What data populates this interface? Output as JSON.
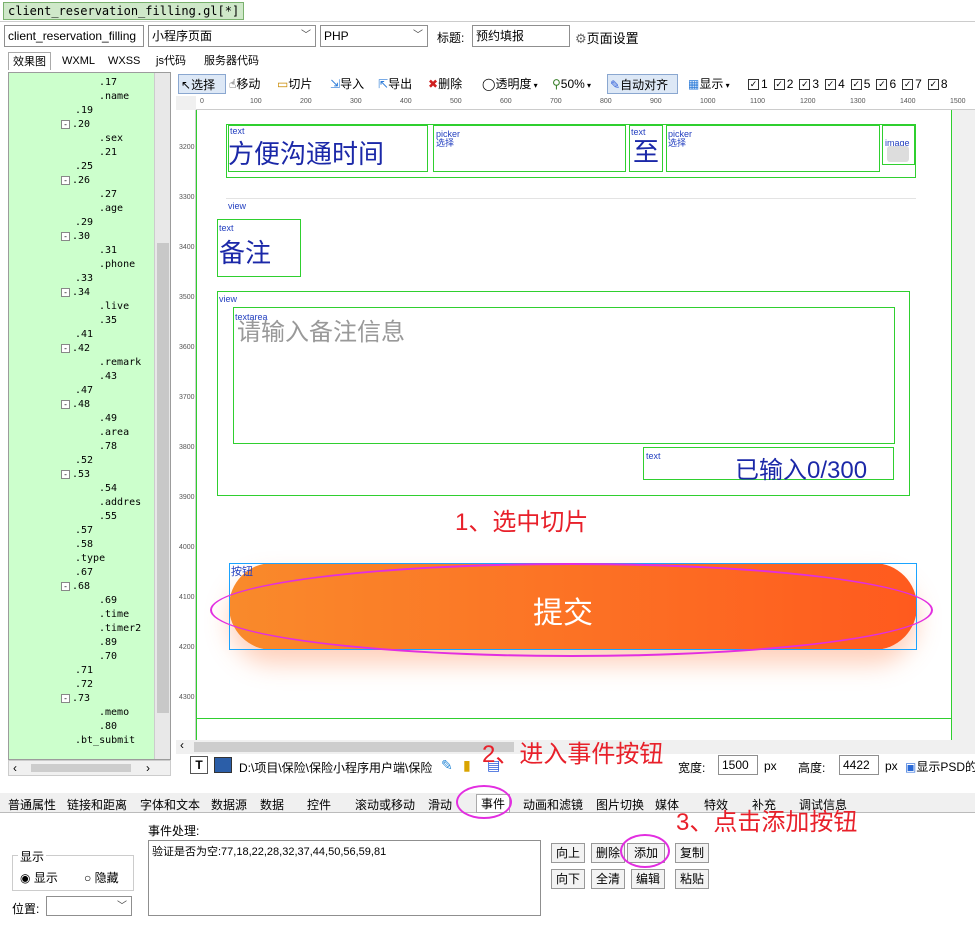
{
  "window": {
    "title_tab": "client_reservation_filling.gl[*]"
  },
  "row1": {
    "page_name": "client_reservation_filling",
    "page_type": "小程序页面",
    "language": "PHP",
    "title_label": "标题:",
    "title_value": "预约填报",
    "page_settings": "页面设置"
  },
  "left_tabs": [
    "效果图",
    "WXML",
    "WXSS",
    "js代码",
    "服务器代码"
  ],
  "tree": {
    "rows": [
      {
        "t": ".17",
        "d": 3
      },
      {
        "t": ".name",
        "d": 3
      },
      {
        "t": ".19",
        "d": 2
      },
      {
        "t": ".20",
        "d": 2,
        "box": "-"
      },
      {
        "t": ".sex",
        "d": 3
      },
      {
        "t": ".21",
        "d": 3
      },
      {
        "t": ".25",
        "d": 2
      },
      {
        "t": ".26",
        "d": 2,
        "box": "-"
      },
      {
        "t": ".27",
        "d": 3
      },
      {
        "t": ".age",
        "d": 3
      },
      {
        "t": ".29",
        "d": 2
      },
      {
        "t": ".30",
        "d": 2,
        "box": "-"
      },
      {
        "t": ".31",
        "d": 3
      },
      {
        "t": ".phone",
        "d": 3
      },
      {
        "t": ".33",
        "d": 2
      },
      {
        "t": ".34",
        "d": 2,
        "box": "-"
      },
      {
        "t": ".live",
        "d": 3
      },
      {
        "t": ".35",
        "d": 3
      },
      {
        "t": ".41",
        "d": 2
      },
      {
        "t": ".42",
        "d": 2,
        "box": "-"
      },
      {
        "t": ".remark",
        "d": 3
      },
      {
        "t": ".43",
        "d": 3
      },
      {
        "t": ".47",
        "d": 2
      },
      {
        "t": ".48",
        "d": 2,
        "box": "-"
      },
      {
        "t": ".49",
        "d": 3
      },
      {
        "t": ".area",
        "d": 3
      },
      {
        "t": ".78",
        "d": 3
      },
      {
        "t": ".52",
        "d": 2
      },
      {
        "t": ".53",
        "d": 2,
        "box": "-"
      },
      {
        "t": ".54",
        "d": 3
      },
      {
        "t": ".addres",
        "d": 3
      },
      {
        "t": ".55",
        "d": 3
      },
      {
        "t": ".57",
        "d": 2
      },
      {
        "t": ".58",
        "d": 2
      },
      {
        "t": ".type",
        "d": 2
      },
      {
        "t": ".67",
        "d": 2
      },
      {
        "t": ".68",
        "d": 2,
        "box": "-"
      },
      {
        "t": ".69",
        "d": 3
      },
      {
        "t": ".time",
        "d": 3
      },
      {
        "t": ".timer2",
        "d": 3
      },
      {
        "t": ".89",
        "d": 3
      },
      {
        "t": ".70",
        "d": 3
      },
      {
        "t": ".71",
        "d": 2
      },
      {
        "t": ".72",
        "d": 2
      },
      {
        "t": ".73",
        "d": 2,
        "box": "-"
      },
      {
        "t": ".memo",
        "d": 3
      },
      {
        "t": ".80",
        "d": 3
      },
      {
        "t": ".bt_submit",
        "d": 2
      }
    ]
  },
  "toolbar": {
    "select": "选择",
    "move": "移动",
    "slice": "切片",
    "import": "导入",
    "export": "导出",
    "delete": "删除",
    "opacity": "透明度",
    "zoom": "50%",
    "auto_align": "自动对齐",
    "display": "显示",
    "checks": [
      "1",
      "2",
      "3",
      "4",
      "5",
      "6",
      "7",
      "8"
    ]
  },
  "ruler": {
    "h": [
      "0",
      "100",
      "200",
      "300",
      "400",
      "500",
      "600",
      "700",
      "800",
      "900",
      "1000",
      "1100",
      "1200",
      "1300",
      "1400",
      "1500"
    ],
    "v": [
      "3200",
      "3300",
      "3400",
      "3500",
      "3600",
      "3700",
      "3800",
      "3900",
      "4000",
      "4100",
      "4200",
      "4300"
    ]
  },
  "design": {
    "comm_time": "方便沟通时间",
    "to": "至",
    "remark_title": "备注",
    "remark_placeholder": "请输入备注信息",
    "char_count": "已输入0/300",
    "submit": "提交",
    "tags": {
      "view": "view",
      "text": "text",
      "picker": "picker",
      "choose": "选择",
      "image": "image",
      "textarea": "textarea",
      "button": "按钮"
    }
  },
  "canvas_status": {
    "path": "D:\\项目\\保险\\保险小程序用户端\\保险",
    "width_label": "宽度:",
    "width_value": "1500",
    "px1": "px",
    "height_label": "高度:",
    "height_value": "4422",
    "px2": "px",
    "show_psd": "显示PSD的"
  },
  "bottom_tabs": [
    "普通属性",
    "链接和距离",
    "字体和文本",
    "数据源",
    "数据",
    "控件",
    "滚动或移动",
    "滑动",
    "事件",
    "动画和滤镜",
    "图片切换",
    "媒体",
    "特效",
    "补充",
    "调试信息"
  ],
  "events": {
    "label": "事件处理:",
    "content": "验证是否为空:77,18,22,28,32,37,44,50,56,59,81",
    "buttons": [
      "向上",
      "删除",
      "添加",
      "复制",
      "向下",
      "全清",
      "编辑",
      "粘贴"
    ]
  },
  "display_group": {
    "legend": "显示",
    "show": "显示",
    "hide": "隐藏",
    "position_label": "位置:"
  },
  "annotations": {
    "a1": "1、选中切片",
    "a2": "2、进入事件按钮",
    "a3": "3、点击添加按钮"
  },
  "colors": {
    "green_border": "#2fcf2f",
    "tree_bg": "#ccffcc",
    "button_start": "#f98a2b",
    "button_end": "#ff5a1e",
    "annotation": "#e8202a",
    "ring": "#e22ee0"
  }
}
